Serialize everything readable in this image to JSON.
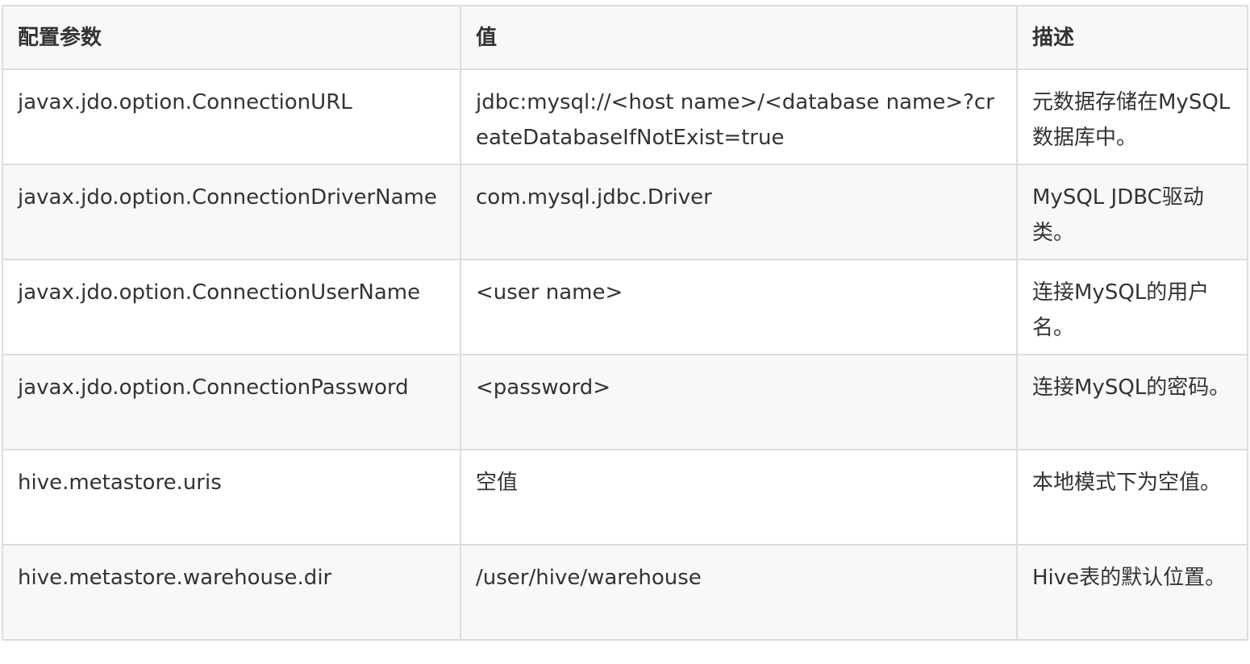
{
  "table": {
    "headers": [
      "配置参数",
      "值",
      "描述"
    ],
    "rows": [
      {
        "param": "javax.jdo.option.ConnectionURL",
        "value": "jdbc:mysql://<host name>/<database name>?createDatabaseIfNotExist=true",
        "desc": "元数据存储在MySQL数据库中。"
      },
      {
        "param": "javax.jdo.option.ConnectionDriverName",
        "value": "com.mysql.jdbc.Driver",
        "desc": "MySQL JDBC驱动类。"
      },
      {
        "param": "javax.jdo.option.ConnectionUserName",
        "value": "<user name>",
        "desc": "连接MySQL的用户名。"
      },
      {
        "param": "javax.jdo.option.ConnectionPassword",
        "value": "<password>",
        "desc": "连接MySQL的密码。"
      },
      {
        "param": "hive.metastore.uris",
        "value": "空值",
        "desc": "本地模式下为空值。"
      },
      {
        "param": "hive.metastore.warehouse.dir",
        "value": "/user/hive/warehouse",
        "desc": "Hive表的默认位置。"
      }
    ]
  },
  "colors": {
    "border": "#dddddd",
    "header_bg": "#f8f8f8",
    "stripe_bg": "#f8f8f8",
    "text": "#333333"
  }
}
